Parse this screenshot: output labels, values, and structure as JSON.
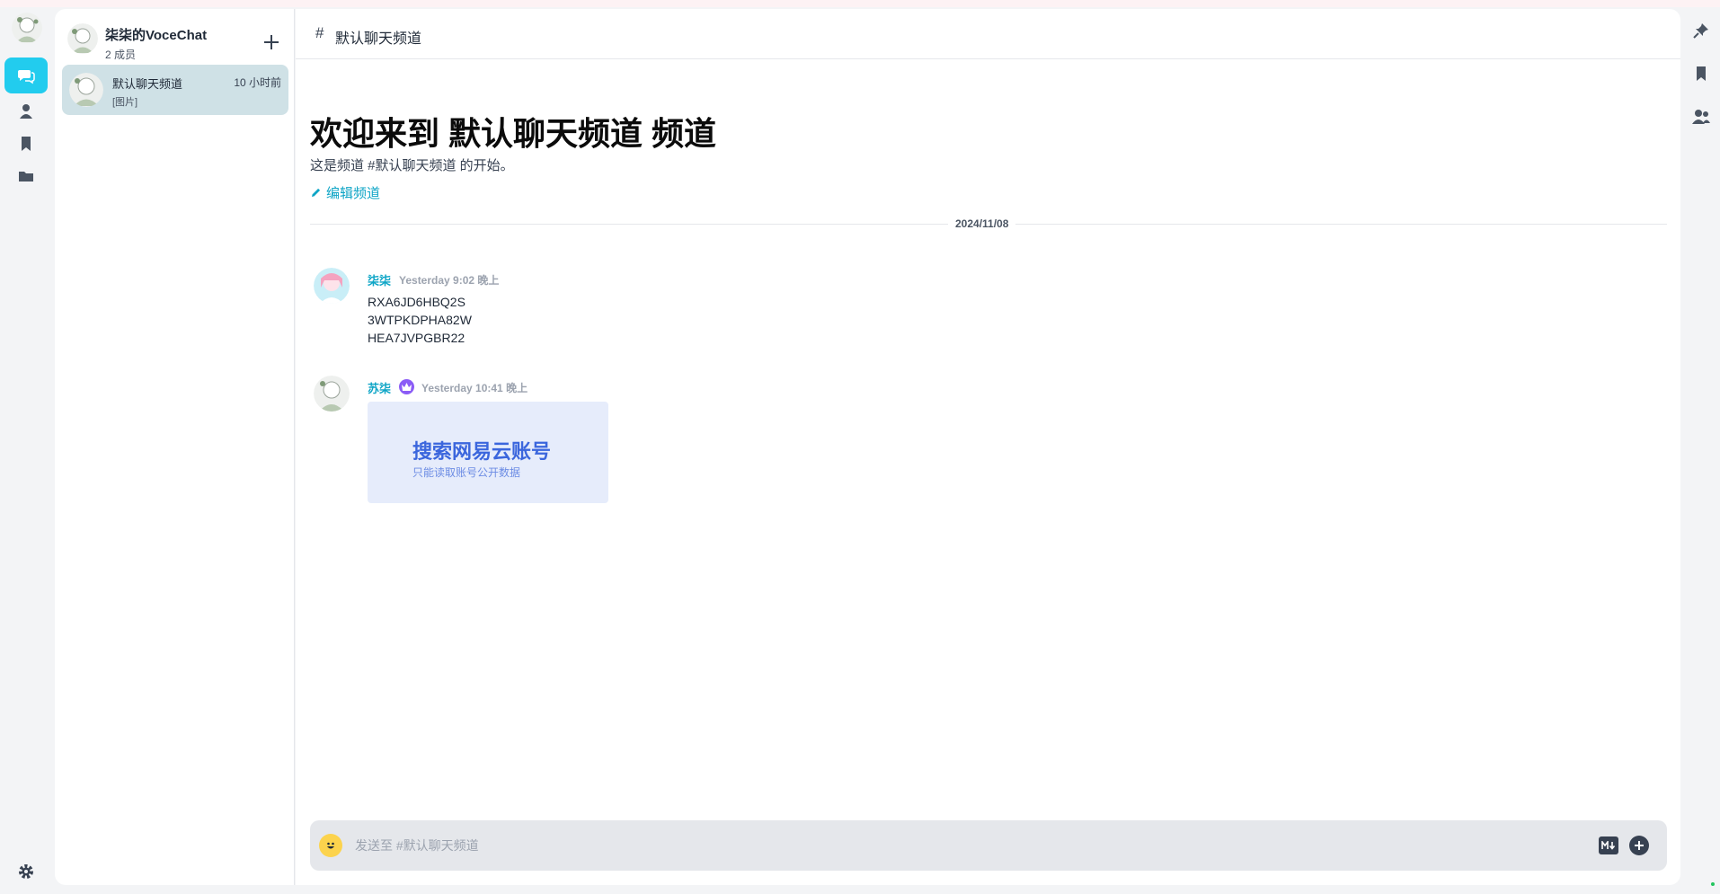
{
  "server": {
    "name": "柒柒的VoceChat",
    "members": "2 成员"
  },
  "sessions": [
    {
      "name": "默认聊天频道",
      "time": "10 小时前",
      "preview": "[图片]"
    }
  ],
  "channel": {
    "hash": "#",
    "name": "默认聊天频道",
    "welcome_title": "欢迎来到 默认聊天频道 频道",
    "welcome_desc": "这是频道 #默认聊天频道 的开始。",
    "edit_label": "编辑频道"
  },
  "date_divider": "2024/11/08",
  "messages": [
    {
      "author": "柒柒",
      "time": "Yesterday 9:02 晚上",
      "lines": [
        "RXA6JD6HBQ2S",
        "3WTPKDPHA82W",
        "HEA7JVPGBR22"
      ]
    },
    {
      "author": "苏柒",
      "time": "Yesterday 10:41 晚上",
      "image": {
        "title": "搜索网易云账号",
        "subtitle": "只能读取账号公开数据"
      }
    }
  ],
  "composer": {
    "placeholder": "发送至 #默认聊天频道"
  },
  "icons": {
    "rail": [
      "chat-icon",
      "user-icon",
      "bookmark-icon",
      "folder-icon",
      "settings-icon"
    ],
    "right": [
      "pin-icon",
      "bookmark-icon",
      "members-icon"
    ]
  },
  "colors": {
    "accent": "#22ccee",
    "link": "#0ea5c6",
    "active_session": "#cfe1e6",
    "owner_badge": "#8b5cf6"
  }
}
